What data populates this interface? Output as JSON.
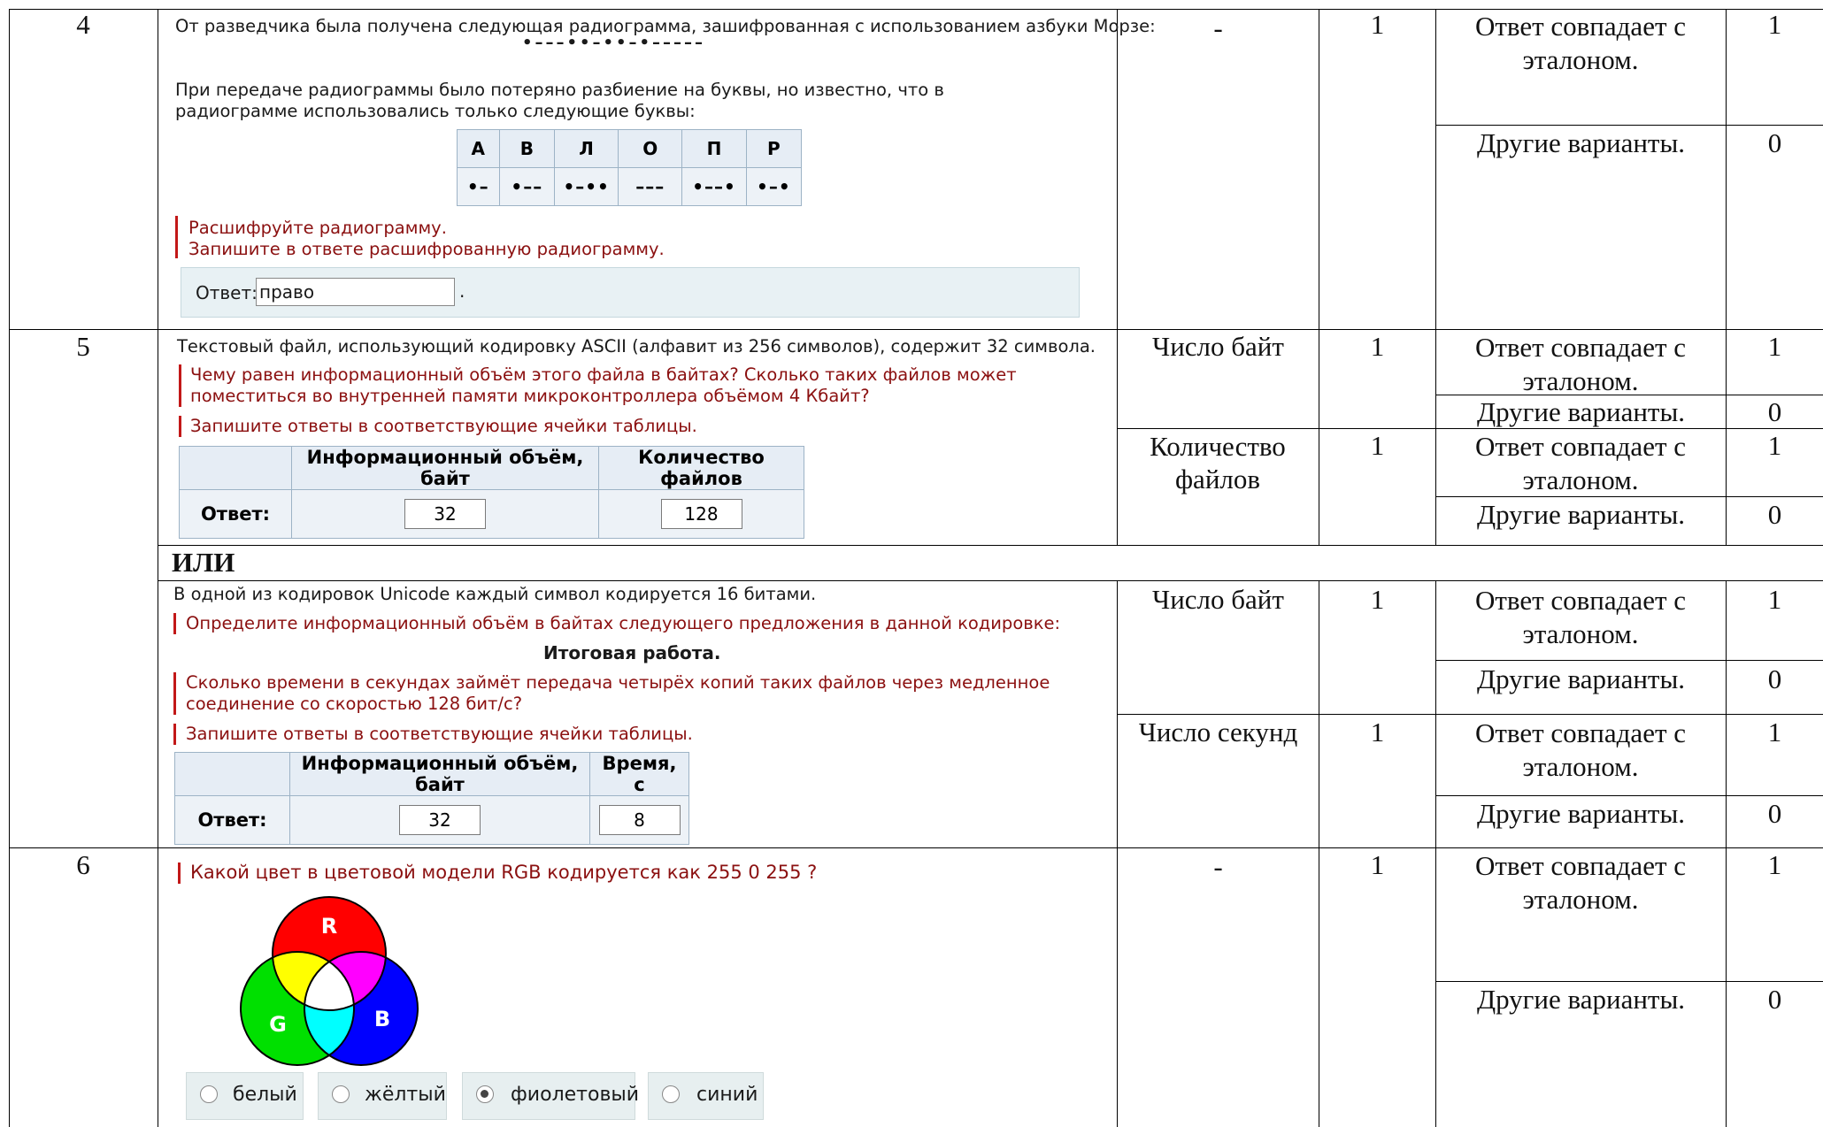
{
  "q4": {
    "number": "4",
    "intro": "От разведчика была получена следующая радиограмма, зашифрованная с использованием азбуки Морзе:",
    "code": "•–––••–••–•–––––",
    "note": "При передаче радиограммы было потеряно разбиение на буквы, но известно, что в радиограмме использовались только следующие буквы:",
    "letters": [
      "А",
      "В",
      "Л",
      "О",
      "П",
      "Р"
    ],
    "codes": [
      "•–",
      "•––",
      "•–••",
      "–––",
      "•––•",
      "•–•"
    ],
    "task1": "Расшифруйте радиограмму.",
    "task2": "Запишите в ответе расшифрованную радиограмму.",
    "answer_label": "Ответ:",
    "answer_value": "право",
    "answer_end": ".",
    "element": "-",
    "points": "1",
    "crit_match": "Ответ совпадает с эталоном.",
    "crit_match_score": "1",
    "crit_other": "Другие варианты.",
    "crit_other_score": "0"
  },
  "q5": {
    "number": "5",
    "intro": "Текстовый файл, использующий кодировку ASCII (алфавит из 256 символов), содержит 32 символа.",
    "question": "Чему равен информационный объём этого файла в байтах? Сколько таких файлов может поместиться во внутренней памяти микроконтроллера объёмом 4 Кбайт?",
    "instruction": "Запишите ответы в соответствующие ячейки таблицы.",
    "col1": "Информационный объём, байт",
    "col2": "Количество файлов",
    "answer_label": "Ответ:",
    "val1": "32",
    "val2": "128",
    "element1": "Число байт",
    "element2": "Количество файлов",
    "points1": "1",
    "points2": "1",
    "crit_match": "Ответ совпадает с эталоном.",
    "crit_other": "Другие варианты.",
    "score1": "1",
    "score0": "0"
  },
  "or_label": "ИЛИ",
  "q5alt": {
    "intro": "В одной из кодировок Unicode каждый символ кодируется 16 битами.",
    "question1": "Определите информационный объём в байтах следующего предложения в данной кодировке:",
    "sentence": "Итоговая работа.",
    "question2": "Сколько времени в секундах займёт передача четырёх копий таких файлов через медленное соединение со скоростью 128 бит/с?",
    "instruction": "Запишите ответы в соответствующие ячейки таблицы.",
    "col1": "Информационный объём, байт",
    "col2": "Время, с",
    "answer_label": "Ответ:",
    "val1": "32",
    "val2": "8",
    "element1": "Число байт",
    "element2": "Число секунд",
    "points1": "1",
    "points2": "1"
  },
  "q6": {
    "number": "6",
    "question": "Какой цвет в цветовой модели RGB кодируется как 255 0 255 ?",
    "venn_labels": [
      "R",
      "G",
      "B"
    ],
    "options": [
      "белый",
      "жёлтый",
      "фиолетовый",
      "синий"
    ],
    "selected": "фиолетовый",
    "element": "-",
    "points": "1"
  },
  "colors": {
    "task_red": "#8b1010",
    "bar_red": "#c21818",
    "table_border": "#9db3c6",
    "answer_bg": "#e8f1f4"
  }
}
